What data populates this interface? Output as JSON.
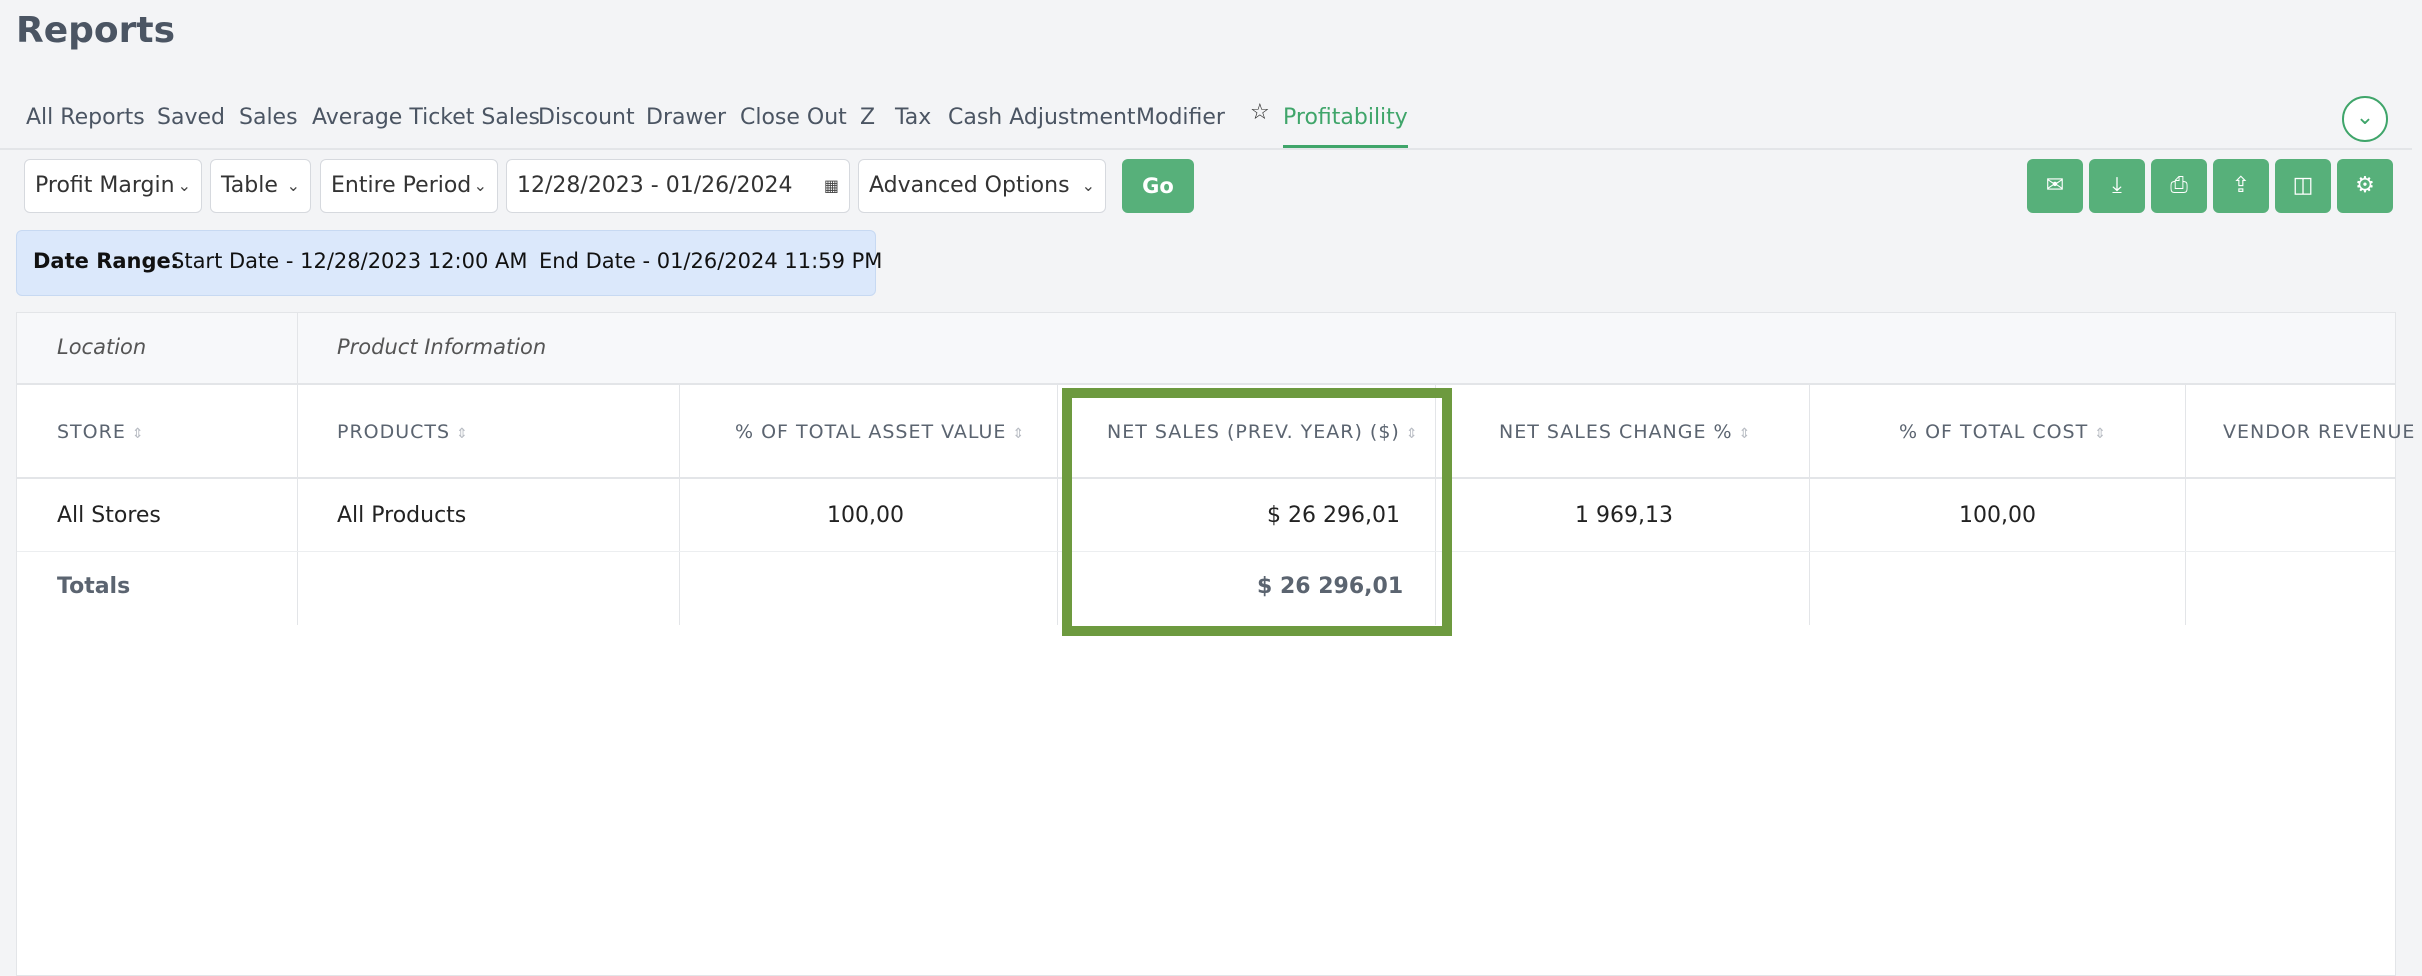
{
  "page": {
    "title": "Reports"
  },
  "tabs": [
    {
      "label": "All Reports"
    },
    {
      "label": "Saved"
    },
    {
      "label": "Sales"
    },
    {
      "label": "Average Ticket Sales"
    },
    {
      "label": "Discount"
    },
    {
      "label": "Drawer"
    },
    {
      "label": "Close Out"
    },
    {
      "label": "Z"
    },
    {
      "label": "Tax"
    },
    {
      "label": "Cash Adjustment"
    },
    {
      "label": "Modifier"
    },
    {
      "label": "Profitability"
    }
  ],
  "active_tab": "Profitability",
  "toolbar": {
    "report_type": "Profit Margin",
    "view": "Table",
    "period": "Entire Period",
    "date_range": "12/28/2023 - 01/26/2024",
    "advanced": "Advanced Options",
    "go_label": "Go",
    "accent": "#57b07a"
  },
  "actions": [
    {
      "icon": "mail-icon",
      "glyph": "✉"
    },
    {
      "icon": "download-icon",
      "glyph": "⤓"
    },
    {
      "icon": "print-icon",
      "glyph": "⎙"
    },
    {
      "icon": "share-icon",
      "glyph": "⇪"
    },
    {
      "icon": "columns-icon",
      "glyph": "◫"
    },
    {
      "icon": "settings-icon",
      "glyph": "⚙"
    }
  ],
  "date_range": {
    "label": "Date Range:",
    "start": "Start Date - 12/28/2023 12:00 AM",
    "end": "End Date - 01/26/2024 11:59 PM"
  },
  "table": {
    "groups": [
      "Location",
      "Product Information"
    ],
    "columns": [
      "STORE",
      "PRODUCTS",
      "% OF TOTAL ASSET VALUE",
      "NET SALES (PREV. YEAR) ($)",
      "NET SALES CHANGE %",
      "% OF TOTAL COST",
      "VENDOR REVENUE"
    ],
    "rows": [
      [
        "All Stores",
        "All Products",
        "100,00",
        "$ 26 296,01",
        "1 969,13",
        "100,00",
        ""
      ]
    ],
    "totals": [
      "Totals",
      "",
      "",
      "$ 26 296,01",
      "",
      "",
      ""
    ]
  },
  "highlight_color": "#6d9a3f"
}
